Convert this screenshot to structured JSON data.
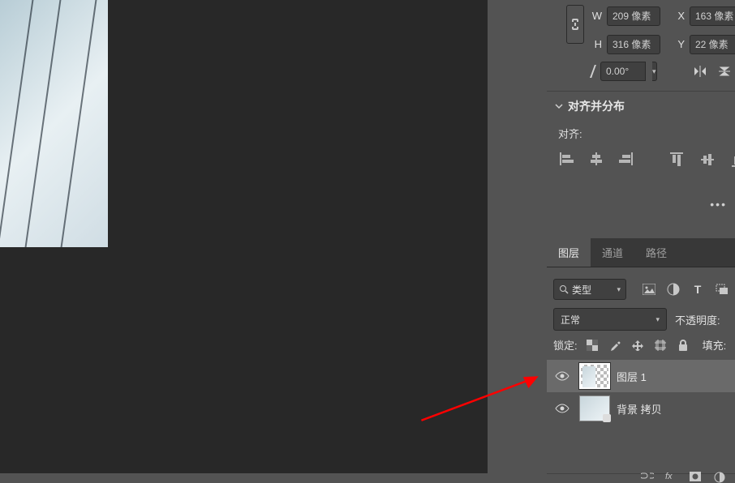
{
  "transform": {
    "w_label": "W",
    "w_value": "209 像素",
    "x_label": "X",
    "x_value": "163 像素",
    "h_label": "H",
    "h_value": "316 像素",
    "y_label": "Y",
    "y_value": "22 像素",
    "angle_value": "0.00°"
  },
  "align_section": {
    "title": "对齐并分布",
    "align_label": "对齐:"
  },
  "panel_tabs": {
    "layers": "图层",
    "channels": "通道",
    "paths": "路径"
  },
  "filter": {
    "type": "类型"
  },
  "blend": {
    "mode": "正常",
    "opacity_label": "不透明度:"
  },
  "lock": {
    "label": "锁定:",
    "fill_label": "填充:"
  },
  "layers": [
    {
      "name": "图层 1",
      "selected": true
    },
    {
      "name": "背景 拷贝",
      "selected": false
    }
  ],
  "bottom": {
    "fx": "fx"
  }
}
